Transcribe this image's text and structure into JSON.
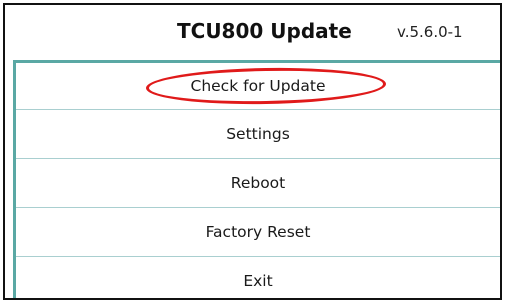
{
  "header": {
    "title": "TCU800 Update",
    "version": "v.5.6.0-1"
  },
  "menu": {
    "items": [
      {
        "label": "Check for Update"
      },
      {
        "label": "Settings"
      },
      {
        "label": "Reboot"
      },
      {
        "label": "Factory Reset"
      },
      {
        "label": "Exit"
      }
    ]
  },
  "colors": {
    "menu_border_accent": "#5aa8a4",
    "menu_divider": "#a9cfd0",
    "highlight_annotation": "#e01a1a"
  }
}
